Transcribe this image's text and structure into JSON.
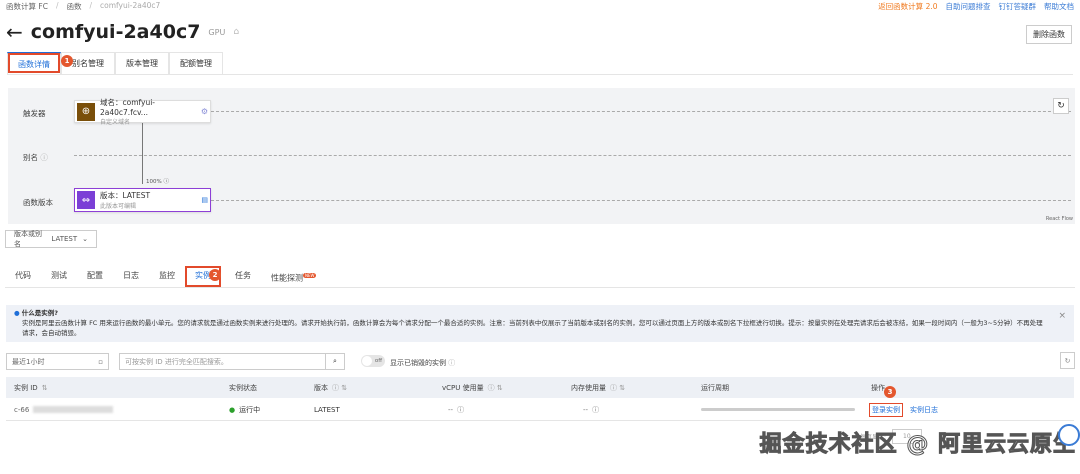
{
  "breadcrumb": [
    "函数计算 FC",
    "函数",
    "comfyui-2a40c7"
  ],
  "top_links": [
    "返回函数计算 2.0",
    "自助问题排查",
    "钉钉答疑群",
    "帮助文档"
  ],
  "title": "comfyui-2a40c7",
  "title_tag": "GPU",
  "delete_button": "删除函数",
  "tabs": [
    "函数详情",
    "别名管理",
    "版本管理",
    "配额管理"
  ],
  "steps": [
    "1",
    "2",
    "3"
  ],
  "graph": {
    "rows": [
      "触发器",
      "别名",
      "函数版本"
    ],
    "trigger_node": {
      "title": "域名：comfyui-2a40c7.fcv...",
      "sub": "自定义域名"
    },
    "version_node": {
      "title": "版本：LATEST",
      "sub": "此版本可编辑"
    },
    "weight": "100%",
    "footer": "React Flow"
  },
  "version_select": {
    "label": "版本或别名",
    "value": "LATEST"
  },
  "subtabs": [
    "代码",
    "测试",
    "配置",
    "日志",
    "监控",
    "实例",
    "任务",
    "性能探测"
  ],
  "new_badge": "NEW",
  "info": {
    "title": "什么是实例?",
    "body": "实例是阿里云函数计算 FC 用来运行函数的最小单元。您的请求就是通过函数实例来进行处理的。请求开始执行前，函数计算会为每个请求分配一个最合适的实例。注意：当前列表中仅展示了当前版本或别名的实例，您可以通过页面上方的版本或别名下拉框进行切换。提示：按量实例在处理完请求后会被冻结，如果一段时间内（一般为3~5分钟）不再处理请求，会自动销毁。"
  },
  "filters": {
    "time": "最近1小时",
    "search_placeholder": "可按实例 ID 进行完全匹配搜索。",
    "toggle": "off",
    "toggle_label": "显示已销毁的实例"
  },
  "table": {
    "headers": [
      "实例 ID",
      "实例状态",
      "版本",
      "vCPU 使用量",
      "内存使用量",
      "运行周期",
      "操作"
    ],
    "rows": [
      {
        "id": "c-66",
        "status": "运行中",
        "version": "LATEST",
        "vcpu": "--",
        "mem": "--",
        "actions": [
          "登录实例",
          "实例日志"
        ]
      }
    ]
  },
  "pagination": {
    "label": "每页显示:",
    "size": "10"
  },
  "watermark": "掘金技术社区 @ 阿里云云原生",
  "colors": {
    "accent": "#1f6fd8",
    "highlight": "#e24a2b",
    "running": "#2ca02c"
  }
}
